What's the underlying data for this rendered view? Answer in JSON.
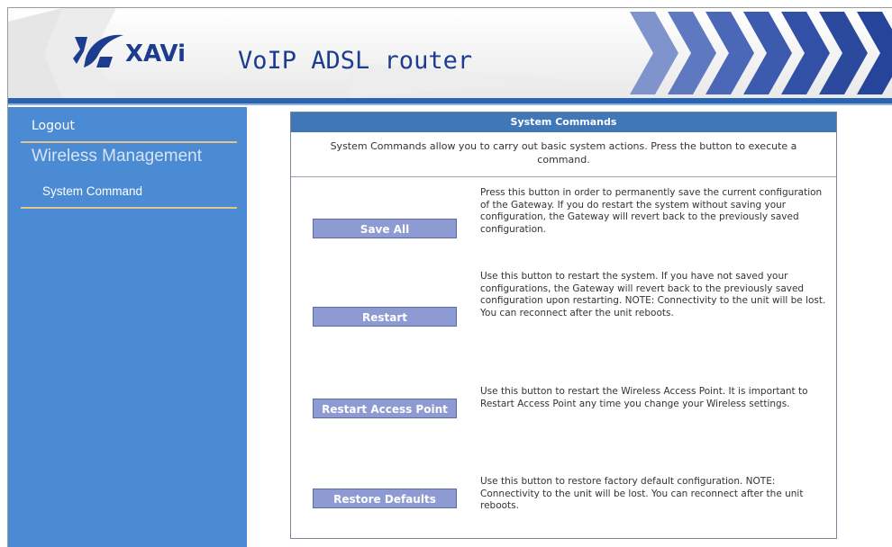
{
  "header": {
    "logo_text": "XAVi",
    "product_title": "VoIP ADSL router"
  },
  "sidebar": {
    "logout_label": "Logout",
    "section_title": "Wireless Management",
    "items": [
      {
        "label": "System Command"
      }
    ]
  },
  "panel": {
    "title": "System Commands",
    "description": "System Commands allow you to carry out basic system actions. Press the button to execute a command.",
    "commands": [
      {
        "button_label": "Save All",
        "description": "Press this button in order to permanently save the current configuration of the Gateway. If you do restart the system without saving your configuration, the Gateway will revert back to the previously saved configuration."
      },
      {
        "button_label": "Restart",
        "description": "Use this button to restart the system. If you have not saved your configurations, the Gateway will revert back to the previously saved configuration upon restarting. NOTE: Connectivity to the unit will be lost. You can reconnect after the unit reboots."
      },
      {
        "button_label": "Restart Access Point",
        "description": "Use this button to restart the Wireless Access Point. It is important to Restart Access Point any time you change your Wireless settings."
      },
      {
        "button_label": "Restore Defaults",
        "description": "Use this button to restore factory default configuration. NOTE: Connectivity to the unit will be lost. You can reconnect after the unit reboots."
      }
    ]
  },
  "colors": {
    "sidebar_bg": "#4a8bd4",
    "panel_header_bg": "#3f77b8",
    "button_bg": "#8e9ad2",
    "brand_blue": "#1c3d8f",
    "divider_gold": "#e3c48a"
  },
  "icons": {
    "logo": "xavi-logo-icon",
    "banner_decoration": "chevron-arrows-icon"
  }
}
